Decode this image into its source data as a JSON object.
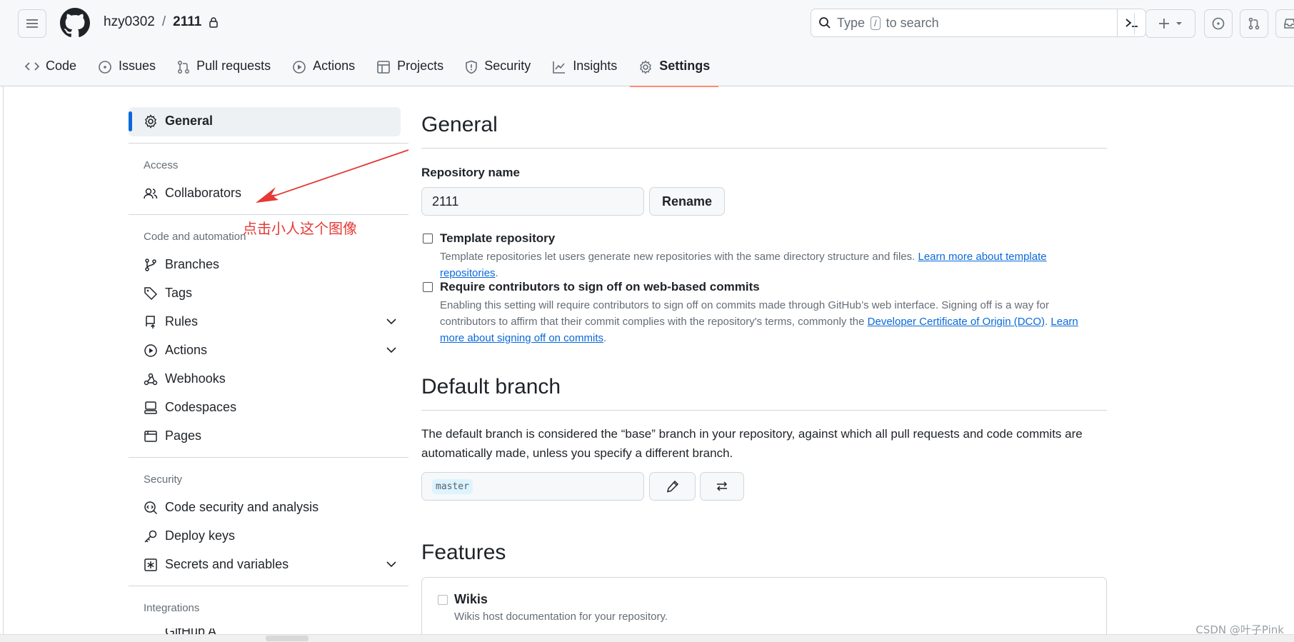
{
  "header": {
    "owner": "hzy0302",
    "separator": "/",
    "repo": "2111",
    "search_prefix": "Type",
    "search_kbd": "/",
    "search_suffix": "to search",
    "icons": [
      "hamburger-icon",
      "github-logo-icon",
      "lock-icon",
      "search-icon",
      "command-palette-icon",
      "plus-icon",
      "triangle-down-icon",
      "issue-opened-icon",
      "pull-request-icon",
      "inbox-icon"
    ]
  },
  "tabs": [
    {
      "label": "Code",
      "icon": "code-icon"
    },
    {
      "label": "Issues",
      "icon": "issue-opened-icon"
    },
    {
      "label": "Pull requests",
      "icon": "git-pull-request-icon"
    },
    {
      "label": "Actions",
      "icon": "play-icon"
    },
    {
      "label": "Projects",
      "icon": "table-icon"
    },
    {
      "label": "Security",
      "icon": "shield-icon"
    },
    {
      "label": "Insights",
      "icon": "graph-icon"
    },
    {
      "label": "Settings",
      "icon": "gear-icon",
      "active": true
    }
  ],
  "sidebar": {
    "general": "General",
    "access_heading": "Access",
    "collaborators": "Collaborators",
    "code_heading": "Code and automation",
    "branches": "Branches",
    "tags": "Tags",
    "rules": "Rules",
    "actions": "Actions",
    "webhooks": "Webhooks",
    "codespaces": "Codespaces",
    "pages": "Pages",
    "security_heading": "Security",
    "code_security": "Code security and analysis",
    "deploy_keys": "Deploy keys",
    "secrets": "Secrets and variables",
    "integrations_heading": "Integrations",
    "github_apps_partial": "GitHub A"
  },
  "annotation": {
    "text": "点击小人这个图像",
    "color": "#e53935"
  },
  "main": {
    "general_title": "General",
    "repo_name_label": "Repository name",
    "repo_name_value": "2111",
    "rename_button": "Rename",
    "template_title": "Template repository",
    "template_desc": "Template repositories let users generate new repositories with the same directory structure and files.",
    "template_link": "Learn more about template repositories",
    "template_period": ".",
    "signoff_title": "Require contributors to sign off on web-based commits",
    "signoff_desc": "Enabling this setting will require contributors to sign off on commits made through GitHub’s web interface. Signing off is a way for contributors to affirm that their commit complies with the repository's terms, commonly the",
    "signoff_link1": "Developer Certificate of Origin (DCO)",
    "signoff_mid": ".",
    "signoff_link2": "Learn more about signing off on commits",
    "signoff_end": ".",
    "default_branch_title": "Default branch",
    "default_branch_desc": "The default branch is considered the “base” branch in your repository, against which all pull requests and code commits are automatically made, unless you specify a different branch.",
    "default_branch_value": "master",
    "features_title": "Features",
    "wikis_title": "Wikis",
    "wikis_desc": "Wikis host documentation for your repository."
  },
  "watermark": "CSDN @叶子Pink",
  "colors": {
    "accent": "#0969da",
    "tab_underline": "#fd8c73",
    "annotation": "#e53935"
  }
}
